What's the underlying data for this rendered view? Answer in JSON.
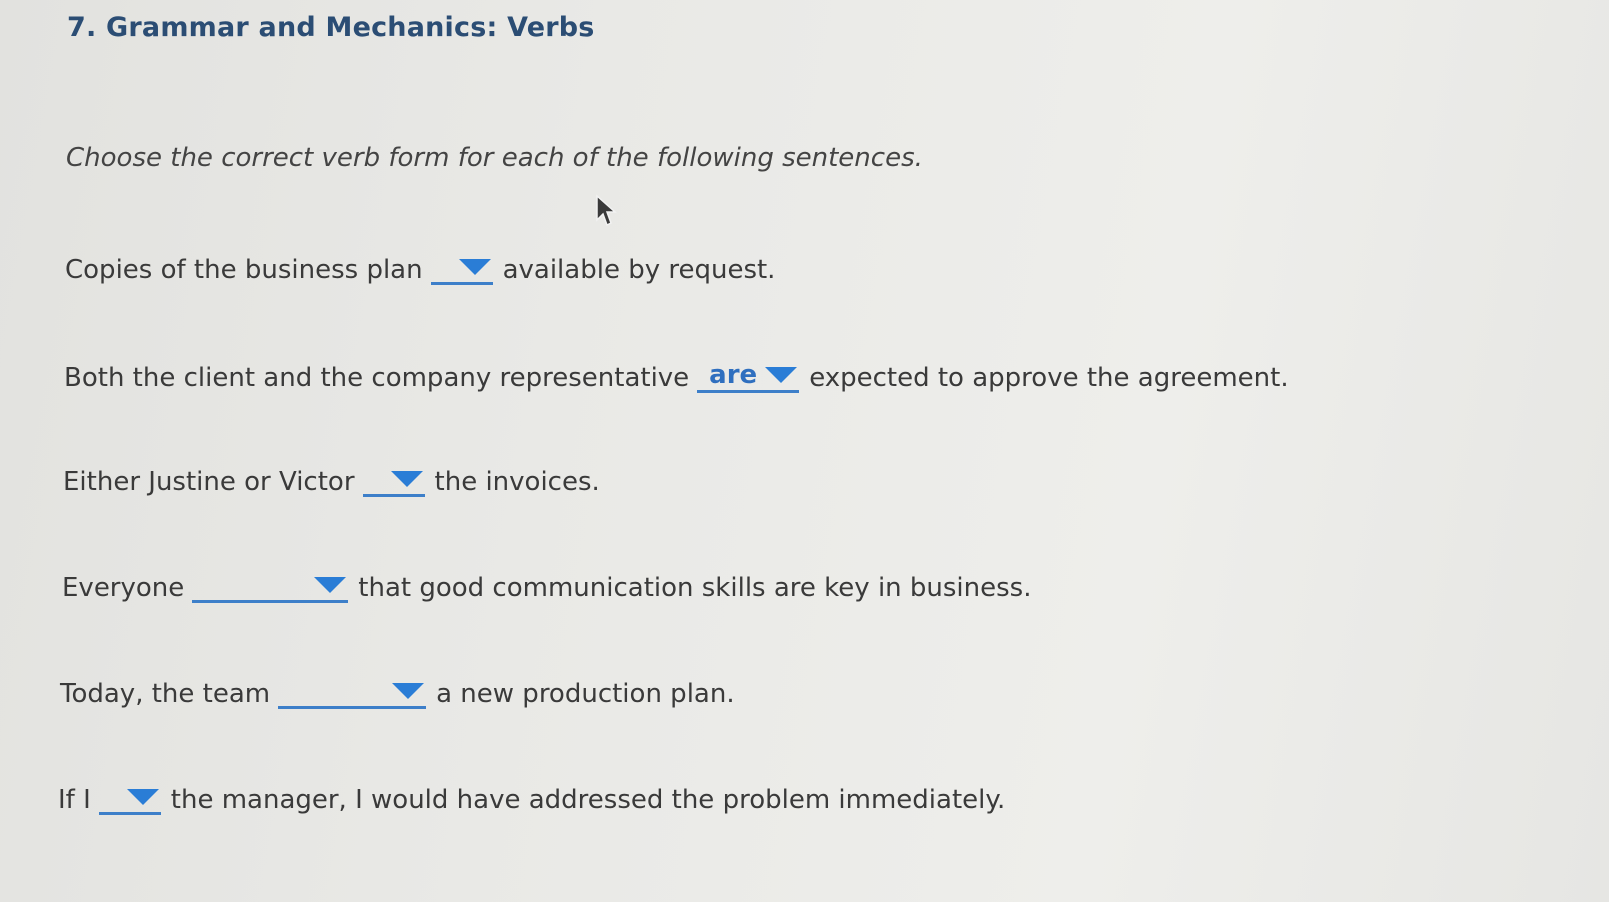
{
  "heading": "7. Grammar and Mechanics: Verbs",
  "instructions": "Choose the correct verb form for each of the following sentences.",
  "questions": [
    {
      "before": "Copies of the business plan",
      "selected": "",
      "after": "available by request."
    },
    {
      "before": "Both the client and the company representative",
      "selected": "are",
      "after": "expected to approve the agreement."
    },
    {
      "before": "Either Justine or Victor",
      "selected": "",
      "after": "the invoices."
    },
    {
      "before": "Everyone",
      "selected": "",
      "after": "that good communication skills are key in business."
    },
    {
      "before": "Today, the team",
      "selected": "",
      "after": "a new production plan."
    },
    {
      "before": "If I",
      "selected": "",
      "after": "the manager, I would have addressed the problem immediately."
    }
  ],
  "colors": {
    "heading": "#2b4d74",
    "dropdown_accent": "#2a7dd6",
    "selected_text": "#2f6fbf"
  },
  "icons": {
    "dropdown": "caret-down-icon",
    "pointer": "mouse-pointer-icon"
  }
}
